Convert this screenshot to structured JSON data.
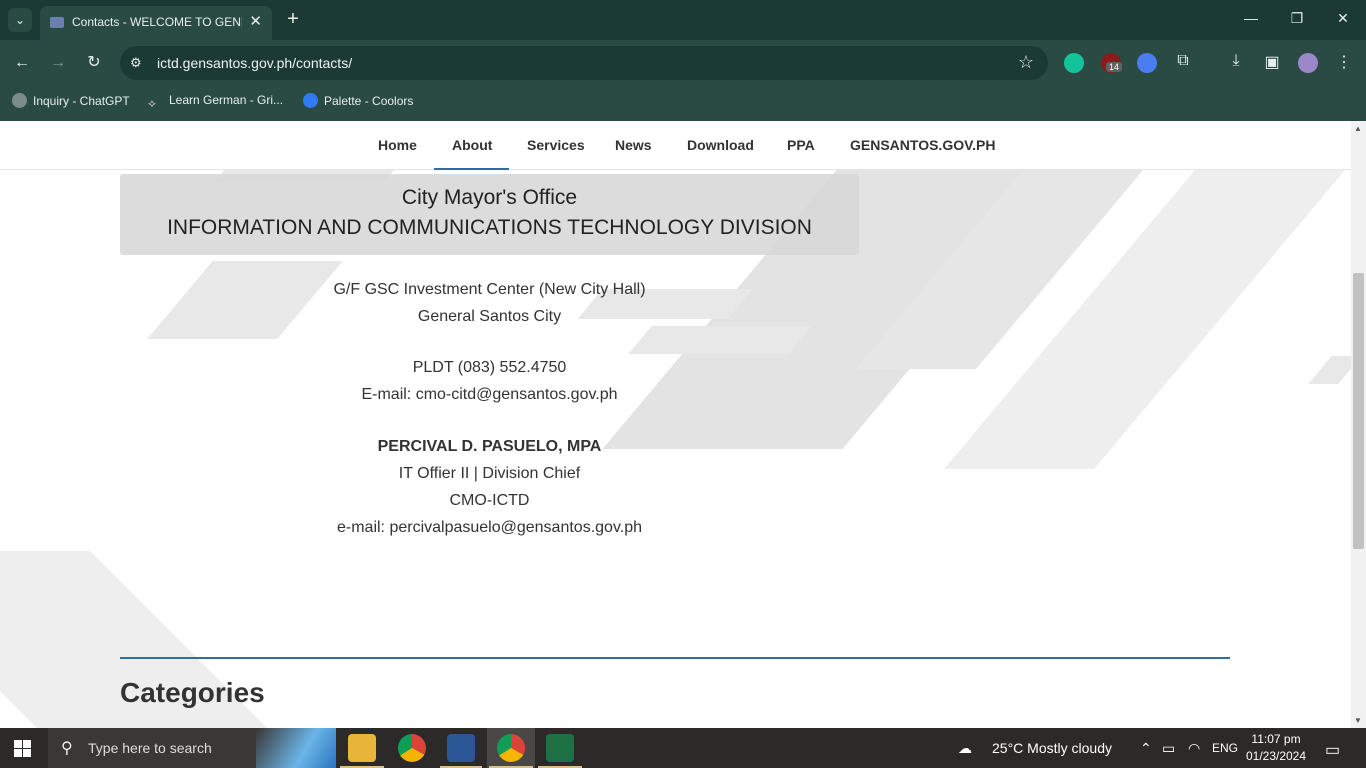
{
  "browser": {
    "tab_title": "Contacts - WELCOME TO GENERAL",
    "url_host": "ictd.gensantos.gov.ph",
    "url_path": "/contacts/",
    "extension_badge": "14",
    "bookmarks": [
      {
        "label": "Inquiry - ChatGPT",
        "icon": "chatgpt-icon"
      },
      {
        "label": "Learn  German - Gri...",
        "icon": "griffin-icon"
      },
      {
        "label": "Palette - Coolors",
        "icon": "coolors-icon"
      }
    ]
  },
  "nav": {
    "items": [
      "Home",
      "About",
      "Services",
      "News",
      "Download",
      "PPA",
      "GENSANTOS.GOV.PH"
    ],
    "active": "About"
  },
  "header": {
    "line1": "City Mayor's Office",
    "line2": "INFORMATION AND COMMUNICATIONS TECHNOLOGY DIVISION"
  },
  "address": {
    "line1": "G/F GSC Investment Center (New City Hall)",
    "line2": "General Santos City"
  },
  "contact": {
    "phone": "PLDT (083) 552.4750",
    "email": "E-mail: cmo-citd@gensantos.gov.ph"
  },
  "chief": {
    "name": "PERCIVAL D. PASUELO, MPA",
    "title": "IT Offier II | Division Chief",
    "office": "CMO-ICTD",
    "email": "e-mail: percivalpasuelo@gensantos.gov.ph"
  },
  "categories": {
    "heading": "Categories"
  },
  "taskbar": {
    "search_placeholder": "Type here to search",
    "weather": "25°C  Mostly cloudy",
    "lang": "ENG",
    "time": "11:07 pm",
    "date": "01/23/2024"
  },
  "colors": {
    "chrome_dark": "#1b3a35",
    "chrome": "#2a4a44",
    "accent_blue": "#2f6da3",
    "taskbar": "#2b2a28"
  }
}
